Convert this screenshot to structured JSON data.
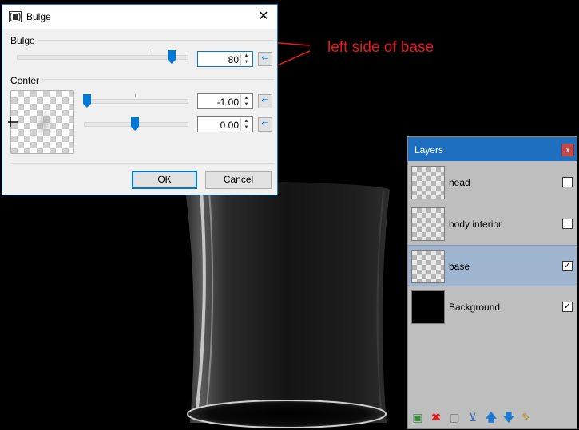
{
  "dialog": {
    "title": "Bulge",
    "close_icon": "close-icon",
    "bulge_group": "Bulge",
    "bulge_value": "80",
    "center_group": "Center",
    "center_x_value": "-1.00",
    "center_y_value": "0.00",
    "ok_label": "OK",
    "cancel_label": "Cancel"
  },
  "annotation": {
    "text": "left side of base",
    "color": "#e21a1a"
  },
  "layers": {
    "title": "Layers",
    "close_label": "x",
    "items": [
      {
        "name": "head",
        "visible": false,
        "selected": false
      },
      {
        "name": "body interior",
        "visible": false,
        "selected": false
      },
      {
        "name": "base",
        "visible": true,
        "selected": true
      },
      {
        "name": "Background",
        "visible": true,
        "selected": false
      }
    ],
    "toolbar_icons": [
      "add-layer-icon",
      "delete-layer-icon",
      "duplicate-layer-icon",
      "merge-layer-down-icon",
      "move-layer-up-icon",
      "move-layer-down-icon",
      "layer-properties-icon"
    ]
  },
  "colors": {
    "accent": "#0078d7",
    "layers_title_bar": "#1e6fbf",
    "selected_row": "#9fb5cf"
  }
}
